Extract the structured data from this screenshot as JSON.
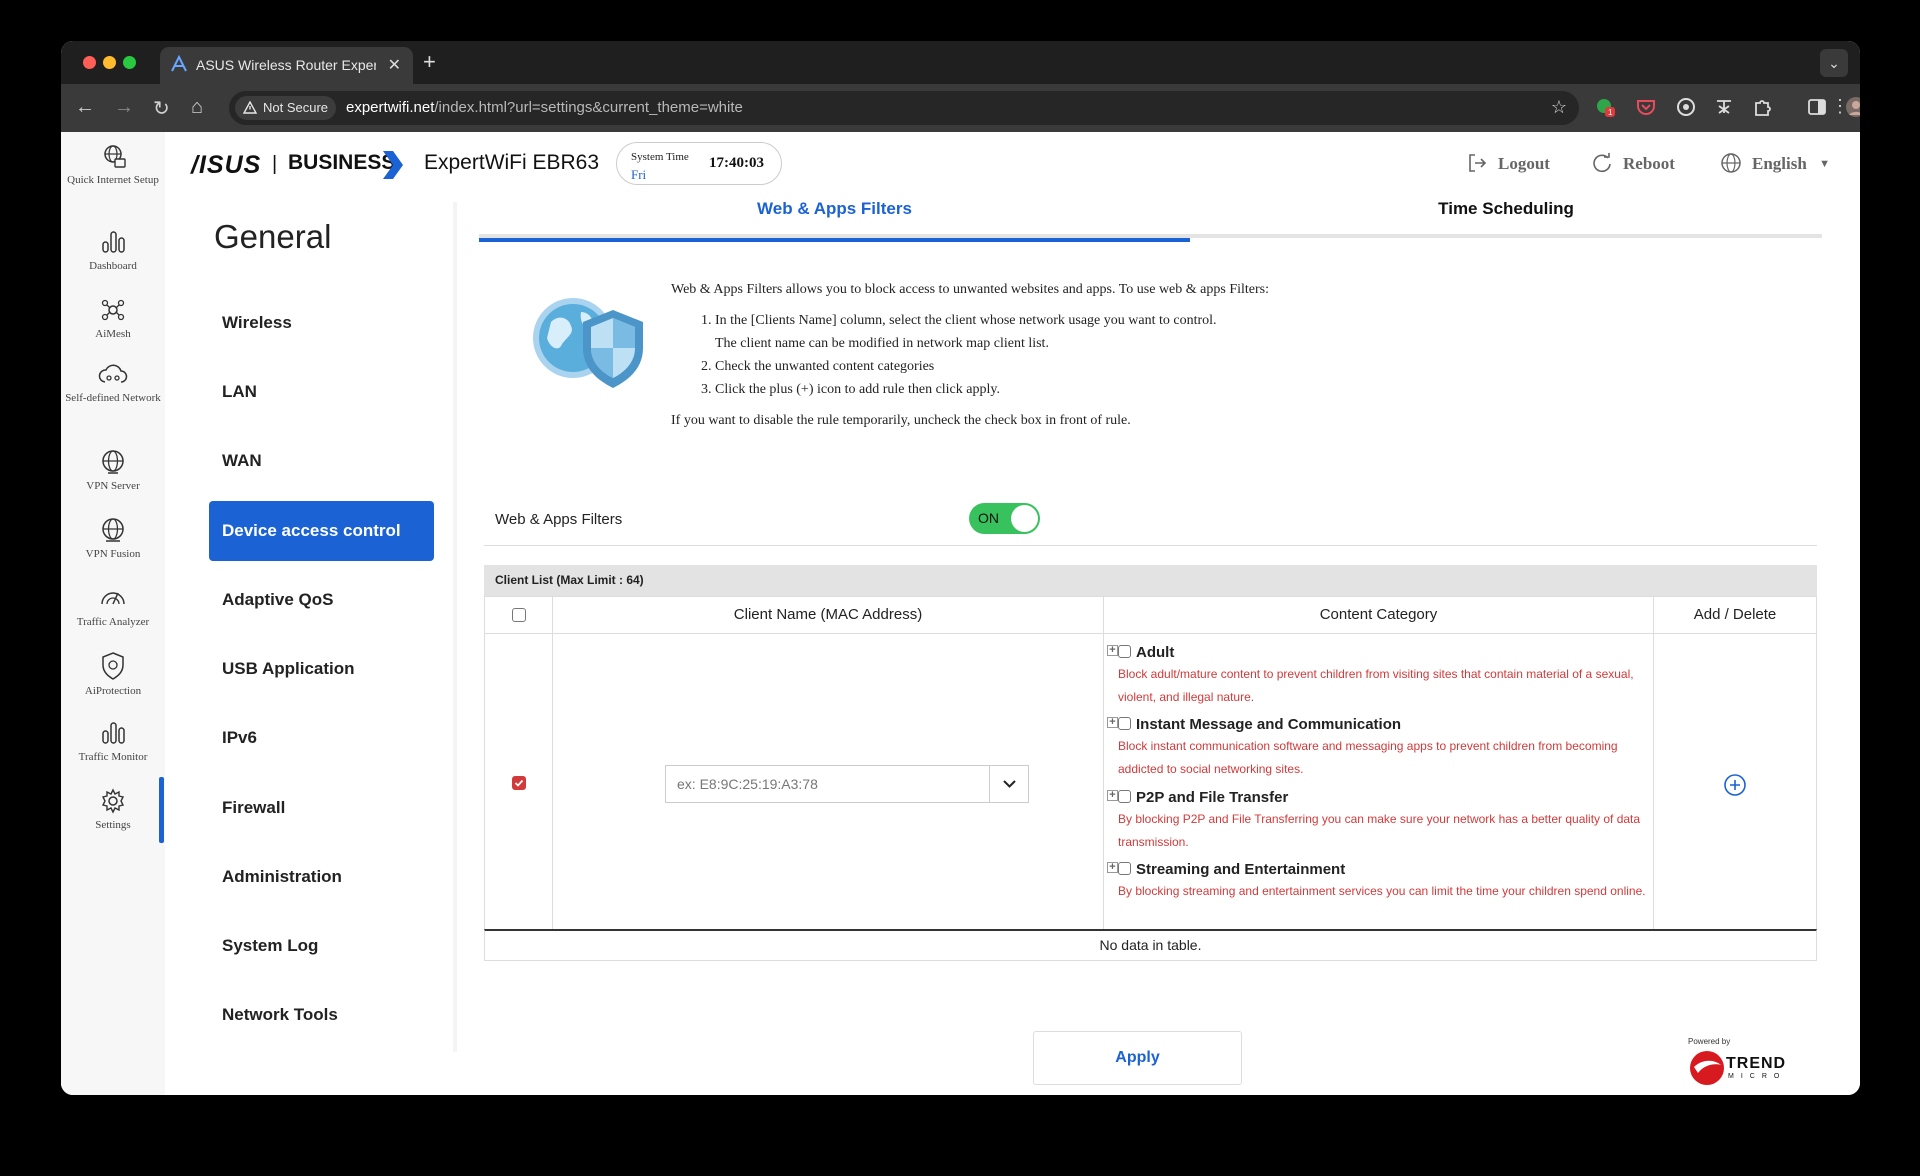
{
  "browser": {
    "tab_title": "ASUS Wireless Router Exper",
    "security_label": "Not Secure",
    "url_host": "expertwifi.net",
    "url_path": "/index.html?url=settings&current_theme=white",
    "ext_badge": "1"
  },
  "iconbar": {
    "items": [
      {
        "label": "Quick Internet Setup"
      },
      {
        "label": "Dashboard"
      },
      {
        "label": "AiMesh"
      },
      {
        "label": "Self-defined Network"
      },
      {
        "label": "VPN Server"
      },
      {
        "label": "VPN Fusion"
      },
      {
        "label": "Traffic Analyzer"
      },
      {
        "label": "AiProtection"
      },
      {
        "label": "Traffic Monitor"
      },
      {
        "label": "Settings"
      }
    ]
  },
  "header": {
    "brand_asus": "/ISUS",
    "brand_business": "BUSINESS",
    "model": "ExpertWiFi EBR63",
    "system_time_label": "System Time",
    "day": "Fri",
    "time": "17:40:03",
    "logout": "Logout",
    "reboot": "Reboot",
    "language": "English"
  },
  "menu": {
    "title": "General",
    "items": [
      "Wireless",
      "LAN",
      "WAN",
      "Device access control",
      "Adaptive QoS",
      "USB Application",
      "IPv6",
      "Firewall",
      "Administration",
      "System Log",
      "Network Tools"
    ],
    "active": "Device access control"
  },
  "tabs": {
    "active": "Web & Apps Filters",
    "other": "Time Scheduling"
  },
  "intro": {
    "lead": "Web & Apps Filters allows you to block access to unwanted websites and apps. To use web & apps Filters:",
    "step1a": "In the [Clients Name] column, select the client whose network usage you want to control.",
    "step1b": "The client name can be modified in network map client list.",
    "step2": "Check the unwanted content categories",
    "step3": "Click the plus (+) icon to add rule then click apply.",
    "note": "If you want to disable the rule temporarily, uncheck the check box in front of rule."
  },
  "filter_toggle": {
    "label": "Web & Apps Filters",
    "state": "ON"
  },
  "client_table": {
    "title": "Client List (Max Limit : 64)",
    "col_client": "Client Name (MAC Address)",
    "col_category": "Content Category",
    "col_action": "Add / Delete",
    "mac_placeholder": "ex: E8:9C:25:19:A3:78",
    "categories": [
      {
        "name": "Adult",
        "desc": "Block adult/mature content to prevent children from visiting sites that contain material of a sexual, violent, and illegal nature."
      },
      {
        "name": "Instant Message and Communication",
        "desc": "Block instant communication software and messaging apps to prevent children from becoming addicted to social networking sites."
      },
      {
        "name": "P2P and File Transfer",
        "desc": "By blocking P2P and File Transferring you can make sure your network has a better quality of data transmission."
      },
      {
        "name": "Streaming and Entertainment",
        "desc": "By blocking streaming and entertainment services you can limit the time your children spend online."
      }
    ],
    "empty_text": "No data in table."
  },
  "apply_label": "Apply",
  "powered_by": {
    "label": "Powered by",
    "name": "TREND",
    "sub": "MICRO"
  },
  "colors": {
    "accent": "#1b62d5",
    "toggle_on": "#37c25d",
    "warning": "#d23a3a"
  }
}
